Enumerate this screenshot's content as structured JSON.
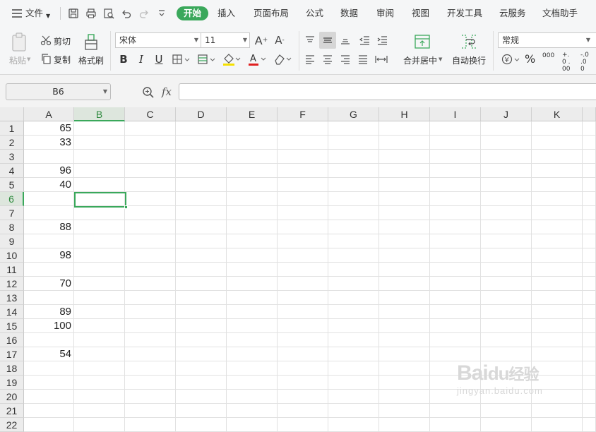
{
  "menubar": {
    "file_label": "文件",
    "tabs": [
      "开始",
      "插入",
      "页面布局",
      "公式",
      "数据",
      "审阅",
      "视图",
      "开发工具",
      "云服务",
      "文档助手"
    ],
    "active_tab": "开始"
  },
  "ribbon": {
    "paste_label": "粘贴",
    "cut_label": "剪切",
    "copy_label": "复制",
    "format_painter_label": "格式刷",
    "font_name": "宋体",
    "font_size": "11",
    "merge_center_label": "合并居中",
    "wrap_text_label": "自动换行",
    "number_format": "常规",
    "percent_symbol": "%",
    "thousands_symbol": "000",
    "inc_decimal_label": "+.0 .00",
    "dec_decimal_label": "-.0 .00",
    "colors": {
      "accent": "#3aa85b",
      "font_color_bar": "#e02020",
      "fill_color_bar": "#f5e000"
    }
  },
  "formula_bar": {
    "cell_ref": "B6",
    "fx_label": "fx",
    "formula": ""
  },
  "sheet": {
    "columns": [
      "A",
      "B",
      "C",
      "D",
      "E",
      "F",
      "G",
      "H",
      "I",
      "J",
      "K"
    ],
    "selected_column": "B",
    "selected_row": "6",
    "rows": [
      {
        "n": "1",
        "a": "65"
      },
      {
        "n": "2",
        "a": "33"
      },
      {
        "n": "3",
        "a": ""
      },
      {
        "n": "4",
        "a": "96"
      },
      {
        "n": "5",
        "a": "40"
      },
      {
        "n": "6",
        "a": ""
      },
      {
        "n": "7",
        "a": ""
      },
      {
        "n": "8",
        "a": "88"
      },
      {
        "n": "9",
        "a": ""
      },
      {
        "n": "10",
        "a": "98"
      },
      {
        "n": "11",
        "a": ""
      },
      {
        "n": "12",
        "a": "70"
      },
      {
        "n": "13",
        "a": ""
      },
      {
        "n": "14",
        "a": "89"
      },
      {
        "n": "15",
        "a": "100"
      },
      {
        "n": "16",
        "a": ""
      },
      {
        "n": "17",
        "a": "54"
      },
      {
        "n": "18",
        "a": ""
      },
      {
        "n": "19",
        "a": ""
      },
      {
        "n": "20",
        "a": ""
      },
      {
        "n": "21",
        "a": ""
      },
      {
        "n": "22",
        "a": ""
      }
    ]
  },
  "watermark": {
    "brand": "Bai",
    "brand_suffix": "经验",
    "url": "jingyan.baidu.com"
  }
}
